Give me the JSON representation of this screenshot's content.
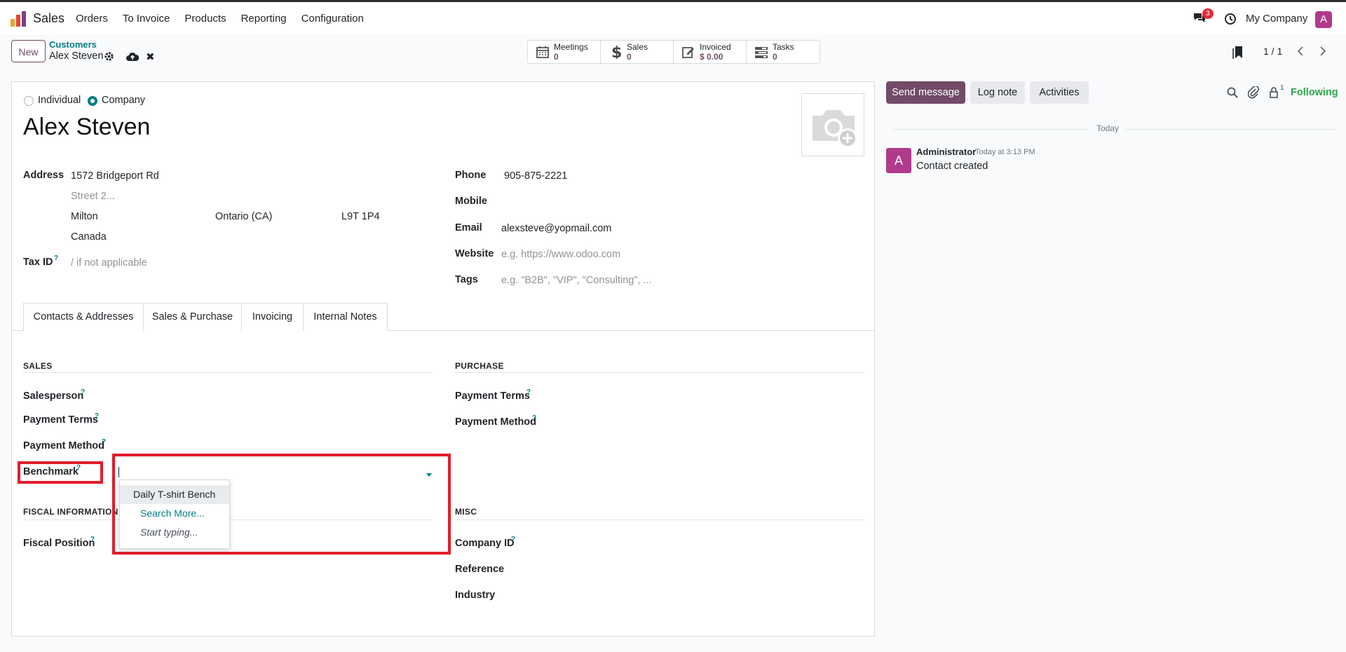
{
  "navbar": {
    "app_name": "Sales",
    "menu": [
      "Orders",
      "To Invoice",
      "Products",
      "Reporting",
      "Configuration"
    ],
    "chat_count": "3",
    "company": "My Company",
    "avatar_letter": "A"
  },
  "control": {
    "new_label": "New",
    "breadcrumb_parent": "Customers",
    "breadcrumb_current": "Alex Steven",
    "stats": [
      {
        "label": "Meetings",
        "value": "0",
        "icon": "calendar-icon"
      },
      {
        "label": "Sales",
        "value": "0",
        "icon": "dollar-icon"
      },
      {
        "label": "Invoiced",
        "value": "$ 0.00",
        "icon": "pencil-square-icon"
      },
      {
        "label": "Tasks",
        "value": "0",
        "icon": "tasks-icon"
      }
    ],
    "pager": "1 / 1"
  },
  "form": {
    "type_options": [
      {
        "label": "Individual",
        "checked": false
      },
      {
        "label": "Company",
        "checked": true
      }
    ],
    "name": "Alex Steven",
    "address_label": "Address",
    "street": "1572 Bridgeport Rd",
    "street2_placeholder": "Street 2...",
    "city": "Milton",
    "state": "Ontario (CA)",
    "zip": "L9T 1P4",
    "country": "Canada",
    "tax_id_label": "Tax ID",
    "tax_id_placeholder": "/ if not applicable",
    "phone_label": "Phone",
    "phone": "905-875-2221",
    "mobile_label": "Mobile",
    "email_label": "Email",
    "email": "alexsteve@yopmail.com",
    "website_label": "Website",
    "website_placeholder": "e.g. https://www.odoo.com",
    "tags_label": "Tags",
    "tags_placeholder": "e.g. \"B2B\", \"VIP\", \"Consulting\", ...",
    "tabs": [
      "Contacts & Addresses",
      "Sales & Purchase",
      "Invoicing",
      "Internal Notes"
    ],
    "active_tab": "Sales & Purchase",
    "sales": {
      "title": "SALES",
      "salesperson_label": "Salesperson",
      "payment_terms_label": "Payment Terms",
      "payment_method_label": "Payment Method",
      "benchmark_label": "Benchmark"
    },
    "purchase": {
      "title": "PURCHASE",
      "payment_terms_label": "Payment Terms",
      "payment_method_label": "Payment Method"
    },
    "fiscal": {
      "title": "FISCAL INFORMATION",
      "fiscal_position_label": "Fiscal Position"
    },
    "misc": {
      "title": "MISC",
      "company_id_label": "Company ID",
      "reference_label": "Reference",
      "industry_label": "Industry"
    },
    "benchmark_dropdown": [
      "Daily T-shirt Bench",
      "Search More...",
      "Start typing..."
    ]
  },
  "chatter": {
    "send_message": "Send message",
    "log_note": "Log note",
    "activities": "Activities",
    "followers_count": "1",
    "following": "Following",
    "today": "Today",
    "message": {
      "avatar_letter": "A",
      "author": "Administrator",
      "time": "Today at 3:13 PM",
      "body": "Contact created"
    }
  },
  "colors": {
    "primary": "#714b67",
    "teal": "#017e84",
    "highlight": "#e11d2a",
    "following": "#28a745"
  }
}
